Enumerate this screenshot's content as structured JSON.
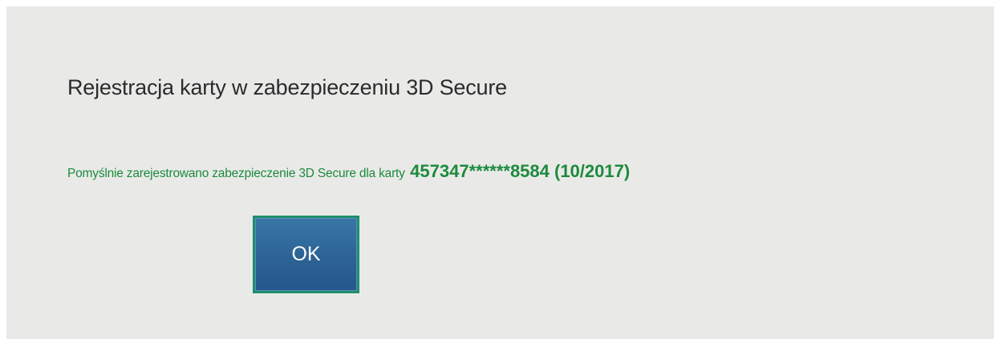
{
  "dialog": {
    "title": "Rejestracja karty w zabezpieczeniu 3D Secure",
    "message": "Pomyślnie zarejestrowano zabezpieczenie 3D Secure dla karty",
    "card_number": "457347******8584 (10/2017)",
    "ok_label": "OK"
  },
  "colors": {
    "background": "#e9eae8",
    "title": "#2b2b2b",
    "success_green": "#1c8a3c",
    "button_blue": "#2d6496",
    "button_border": "#1e8f6b"
  }
}
